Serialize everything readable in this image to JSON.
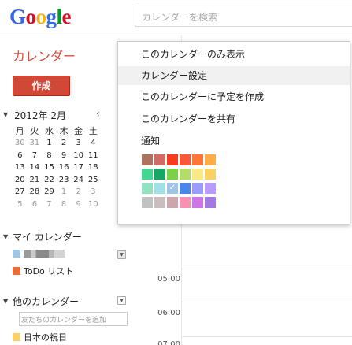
{
  "header": {
    "logo_letters": [
      "G",
      "o",
      "o",
      "g",
      "l",
      "e"
    ],
    "logo_colors": [
      "#3369e8",
      "#d50f25",
      "#eeb211",
      "#3369e8",
      "#009925",
      "#d50f25"
    ],
    "search_placeholder": "カレンダーを検索"
  },
  "sidebar": {
    "app_title": "カレンダー",
    "create_label": "作成",
    "mini_calendar": {
      "title": "2012年 2月",
      "prev_label": "‹",
      "weekdays": [
        "月",
        "火",
        "水",
        "木",
        "金",
        "土"
      ],
      "rows": [
        [
          "30",
          "31",
          "1",
          "2",
          "3",
          "4"
        ],
        [
          "6",
          "7",
          "8",
          "9",
          "10",
          "11"
        ],
        [
          "13",
          "14",
          "15",
          "16",
          "17",
          "18"
        ],
        [
          "20",
          "21",
          "22",
          "23",
          "24",
          "25"
        ],
        [
          "27",
          "28",
          "29",
          "1",
          "2",
          "3"
        ],
        [
          "5",
          "6",
          "7",
          "8",
          "9",
          "10"
        ]
      ],
      "out_of_month": [
        [
          0,
          0
        ],
        [
          0,
          1
        ],
        [
          4,
          3
        ],
        [
          4,
          4
        ],
        [
          4,
          5
        ],
        [
          5,
          0
        ],
        [
          5,
          1
        ],
        [
          5,
          2
        ],
        [
          5,
          3
        ],
        [
          5,
          4
        ],
        [
          5,
          5
        ]
      ]
    },
    "my_calendars": {
      "title": "マイ カレンダー",
      "items": [
        {
          "label": "",
          "color": "#9fc6e7"
        },
        {
          "label": "ToDo リスト",
          "color": "#f06a33"
        }
      ]
    },
    "other_calendars": {
      "title": "他のカレンダー",
      "add_placeholder": "友だちのカレンダーを追加",
      "items": [
        {
          "label": "日本の祝日",
          "color": "#fad165"
        }
      ]
    }
  },
  "grid": {
    "times": [
      "05:00",
      "06:00",
      "07:00"
    ]
  },
  "menu": {
    "items": [
      "このカレンダーのみ表示",
      "カレンダー設定",
      "このカレンダーに予定を作成",
      "このカレンダーを共有",
      "通知"
    ],
    "highlighted_index": 1,
    "palette": [
      [
        "#ac725e",
        "#d06b64",
        "#f83a22",
        "#fa573c",
        "#ff7537",
        "#ffad46"
      ],
      [
        "#42d692",
        "#16a765",
        "#7bd148",
        "#b3dc6c",
        "#fbe983",
        "#fad165"
      ],
      [
        "#92e1c0",
        "#9fe1e7",
        "#9fc6e7",
        "#4986e7",
        "#9a9cff",
        "#b99aff"
      ],
      [
        "#c2c2c2",
        "#cabdbf",
        "#cca6ac",
        "#f691b2",
        "#cd74e6",
        "#a47ae2"
      ]
    ],
    "selected_color": "#9fc6e7"
  }
}
